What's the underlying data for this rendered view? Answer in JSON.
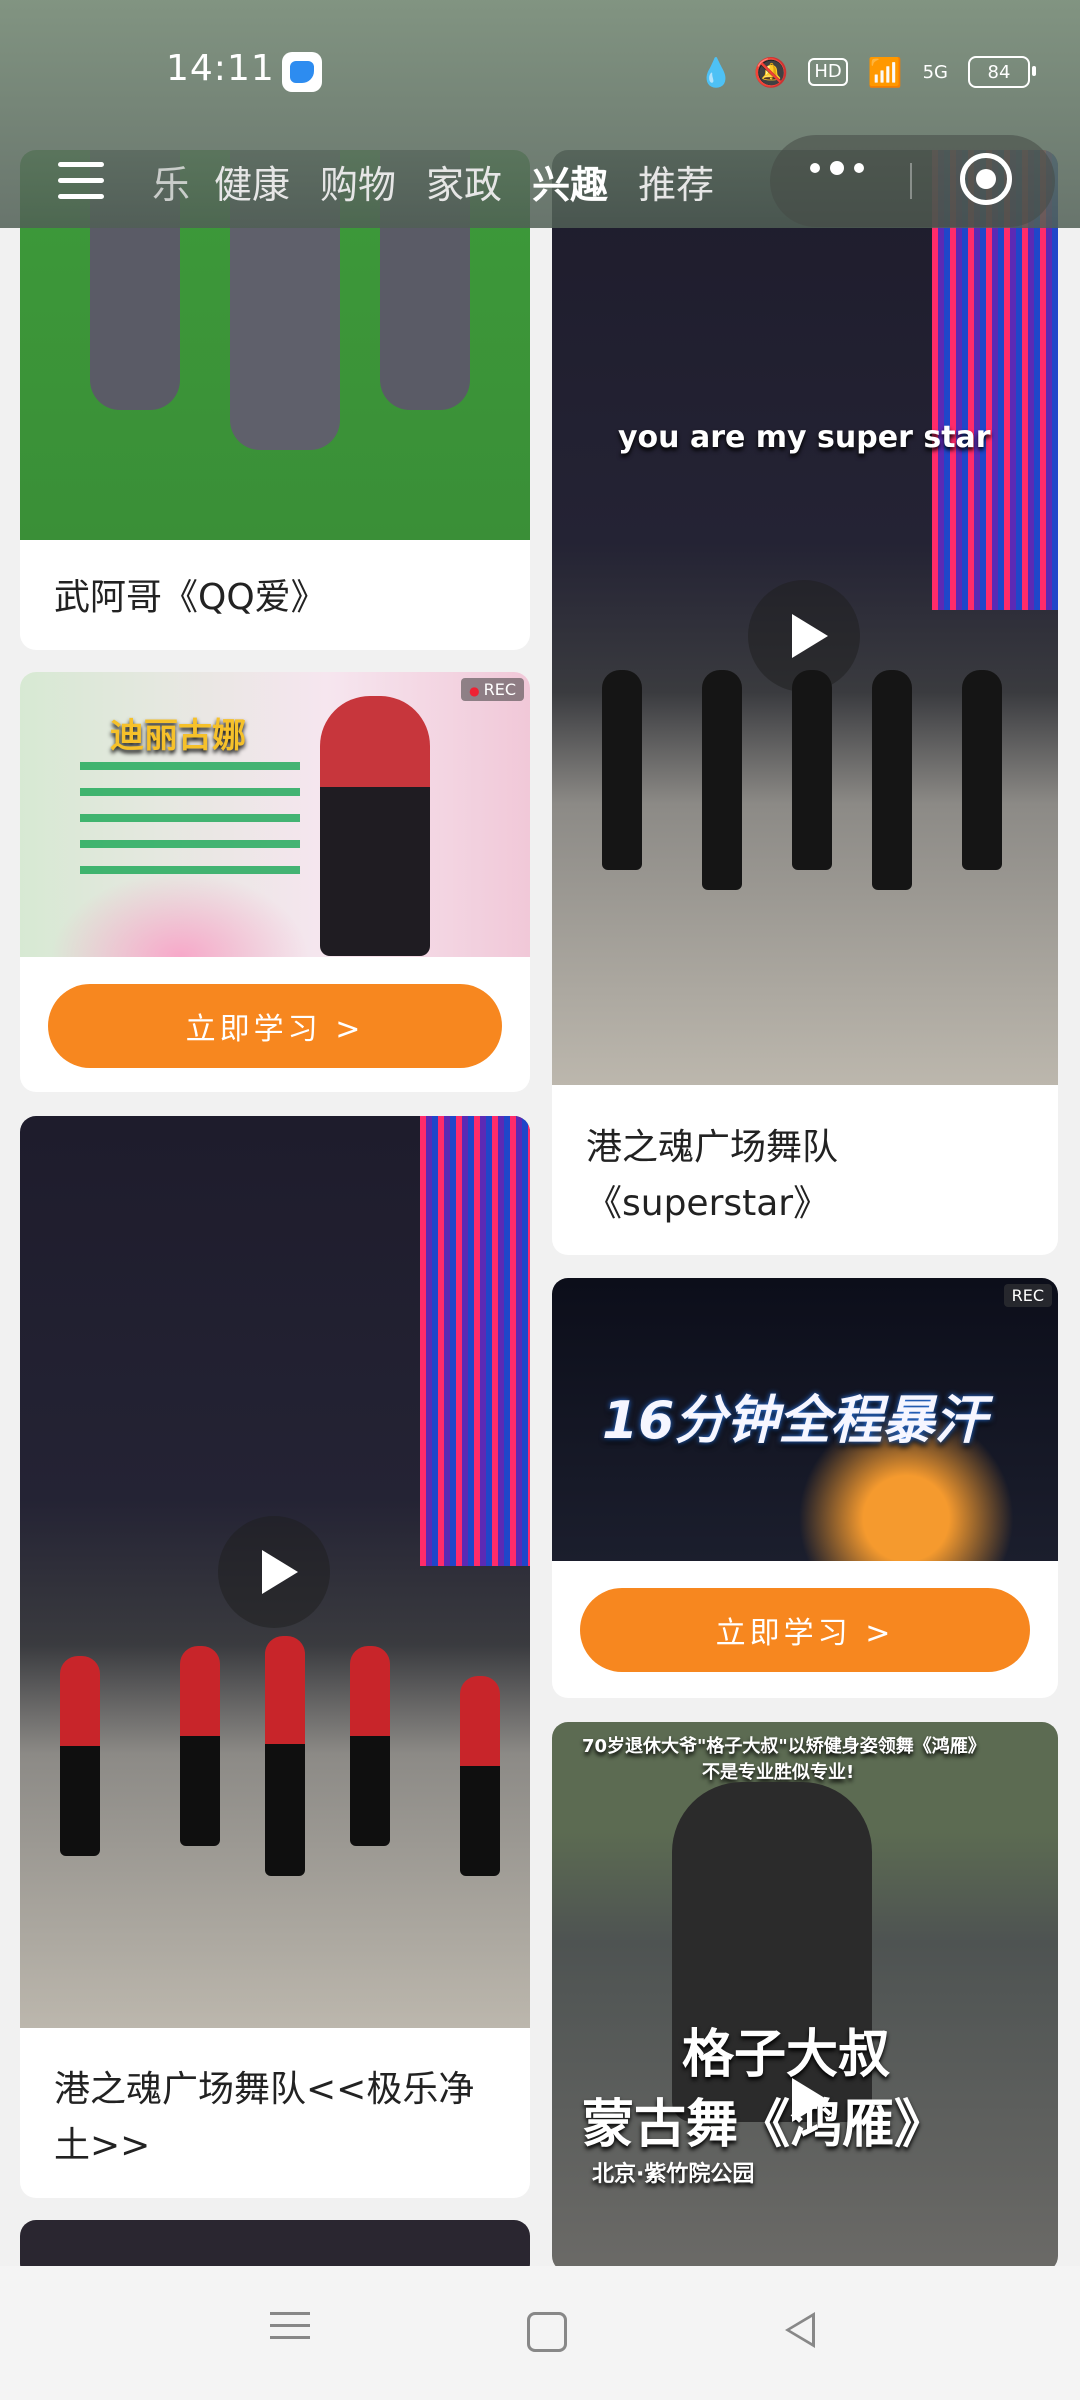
{
  "status_bar": {
    "time": "14:11",
    "network": "5G",
    "hd": "HD",
    "battery": "84"
  },
  "nav": {
    "tabs": [
      "乐",
      "健康",
      "购物",
      "家政",
      "兴趣",
      "推荐"
    ],
    "active_tab": "兴趣"
  },
  "feed": {
    "left": [
      {
        "type": "video",
        "title": "武阿哥《QQ爱》"
      },
      {
        "type": "ad",
        "badge": "REC",
        "headline": "迪丽古娜",
        "cta": "立即学习 >"
      },
      {
        "type": "video",
        "title": "港之魂广场舞队<<极乐净土>>"
      }
    ],
    "right": [
      {
        "type": "video",
        "overlay": "you are my super star",
        "title": "港之魂广场舞队《superstar》"
      },
      {
        "type": "ad",
        "badge": "REC",
        "headline": "16分钟全程暴汗",
        "cta": "立即学习 >"
      },
      {
        "type": "video",
        "overlay_top": "70岁退休大爷\"格子大叔\"以矫健身姿领舞《鸿雁》",
        "overlay_sub": "不是专业胜似专业!",
        "overlay_main1": "格子大叔",
        "overlay_main2": "蒙古舞《鸿雁》",
        "location": "北京·紫竹院公园"
      }
    ]
  },
  "colors": {
    "accent": "#f7871f",
    "background": "#f1f1f1"
  },
  "icons": [
    "menu-icon",
    "more-dots-icon",
    "target-icon",
    "play-icon",
    "nav-menu-icon",
    "nav-home-icon",
    "nav-back-icon"
  ]
}
